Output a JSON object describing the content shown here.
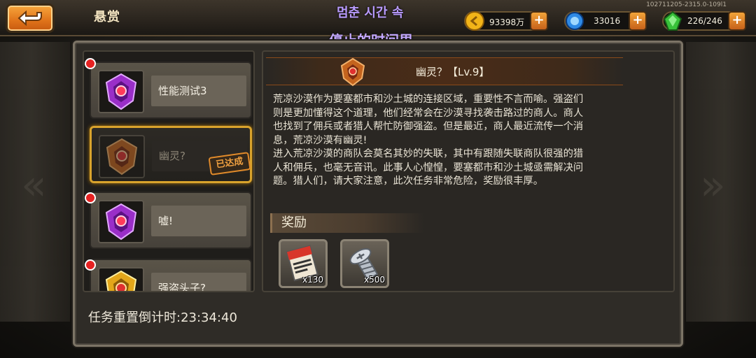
{
  "header": {
    "title": "悬赏",
    "overlay_line1": "멈춘 시간 속",
    "overlay_line2": "停止的时间里",
    "build_id": "102711205-2315.0-109l1"
  },
  "resources": {
    "gold": {
      "value": "93398万",
      "icon": "gold-coin-icon"
    },
    "gems": {
      "value": "33016",
      "icon": "blue-gem-icon"
    },
    "energy": {
      "value": "226/246",
      "icon": "green-crystal-icon"
    }
  },
  "quests": [
    {
      "label": "性能测试3",
      "badge": "purple-rank-badge",
      "new": true
    },
    {
      "label": "幽灵?",
      "badge": "orange-rank-badge",
      "completed": true,
      "stamp": "已达成"
    },
    {
      "label": "嘘!",
      "badge": "purple-rank-badge",
      "new": true
    },
    {
      "label": "强盗头子?",
      "badge": "gold-rank-badge",
      "new": true
    }
  ],
  "timer": "任务重置倒计时:23:34:40",
  "detail": {
    "title": "幽灵？【Lv.9】",
    "text": "荒凉沙漠作为要塞都市和沙土城的连接区域，重要性不言而喻。强盗们\n则是更加懂得这个道理，他们经常会在沙漠寻找袭击路过的商人。商人\n也找到了佣兵或者猎人帮忙防御强盗。但是最近，商人最近流传一个消\n息，荒凉沙漠有幽灵!\n进入荒凉沙漠的商队会莫名其妙的失联，其中有跟随失联商队很强的猎\n人和佣兵，也毫无音讯。此事人心惶惶，要塞都市和沙土城亟需解决问\n题。猎人们，请大家注意，此次任务非常危险，奖励很丰厚。",
    "reward_label": "奖励",
    "rewards": [
      {
        "icon": "ticket-scroll-icon",
        "qty": "x130"
      },
      {
        "icon": "screw-bolt-icon",
        "qty": "x500"
      }
    ]
  },
  "colors": {
    "accent": "#d9a32c",
    "button": "#e0731a",
    "panel": "#2f2c27"
  }
}
